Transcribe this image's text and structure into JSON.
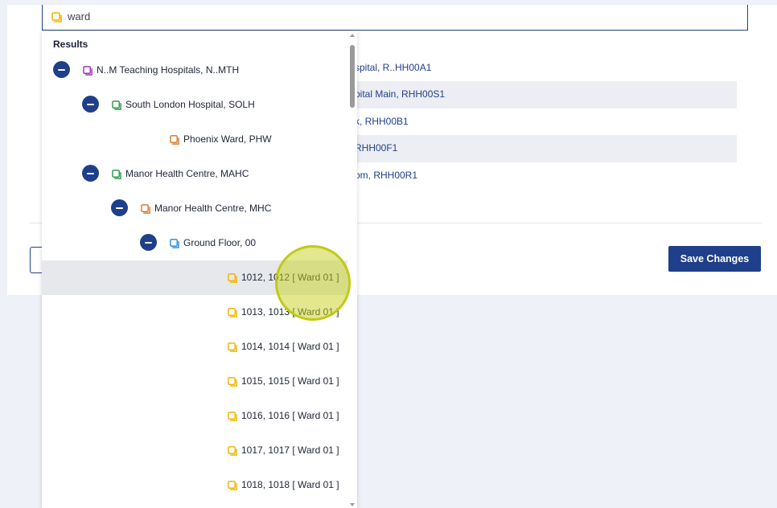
{
  "search": {
    "value": "ward",
    "icon": "folder-icon",
    "icon_color": "#f0b400"
  },
  "background_list": [
    {
      "text": "spital, R..HH00A1",
      "alt": false
    },
    {
      "text": "pital Main, RHH00S1",
      "alt": true
    },
    {
      "text": "k, RHH00B1",
      "alt": false
    },
    {
      "text": "RHH00F1",
      "alt": true
    },
    {
      "text": "om, RHH00R1",
      "alt": false
    }
  ],
  "footer": {
    "save_label": "Save Changes"
  },
  "results": {
    "label": "Results",
    "items": [
      {
        "label": "N..M Teaching Hospitals, N..MTH",
        "expanded": true,
        "icon_color": "#a233b8",
        "level": 0
      },
      {
        "label": "South London Hospital, SOLH",
        "expanded": true,
        "icon_color": "#2f9b4c",
        "level": 1
      },
      {
        "label": "Phoenix Ward, PHW",
        "expanded": false,
        "icon_color": "#d97b2d",
        "level": 2
      },
      {
        "label": "Manor Health Centre, MAHC",
        "expanded": true,
        "icon_color": "#2f9b4c",
        "level": 1
      },
      {
        "label": "Manor Health Centre, MHC",
        "expanded": true,
        "icon_color": "#d97b2d",
        "level": 2
      },
      {
        "label": "Ground Floor, 00",
        "expanded": true,
        "icon_color": "#2e8fd6",
        "level": 3
      },
      {
        "label": "1012, 1012 [ Ward 01 ]",
        "expanded": false,
        "icon_color": "#f0b400",
        "level": 4,
        "highlighted": true
      },
      {
        "label": "1013, 1013 [ Ward 01 ]",
        "expanded": false,
        "icon_color": "#f0b400",
        "level": 4
      },
      {
        "label": "1014, 1014 [ Ward 01 ]",
        "expanded": false,
        "icon_color": "#f0b400",
        "level": 4
      },
      {
        "label": "1015, 1015 [ Ward 01 ]",
        "expanded": false,
        "icon_color": "#f0b400",
        "level": 4
      },
      {
        "label": "1016, 1016 [ Ward 01 ]",
        "expanded": false,
        "icon_color": "#f0b400",
        "level": 4
      },
      {
        "label": "1017, 1017 [ Ward 01 ]",
        "expanded": false,
        "icon_color": "#f0b400",
        "level": 4
      },
      {
        "label": "1018, 1018 [ Ward 01 ]",
        "expanded": false,
        "icon_color": "#f0b400",
        "level": 4
      }
    ]
  },
  "colors": {
    "accent": "#1f3f8a",
    "highlight_row": "#e6e8ec",
    "cursor": "#c8d21e"
  }
}
